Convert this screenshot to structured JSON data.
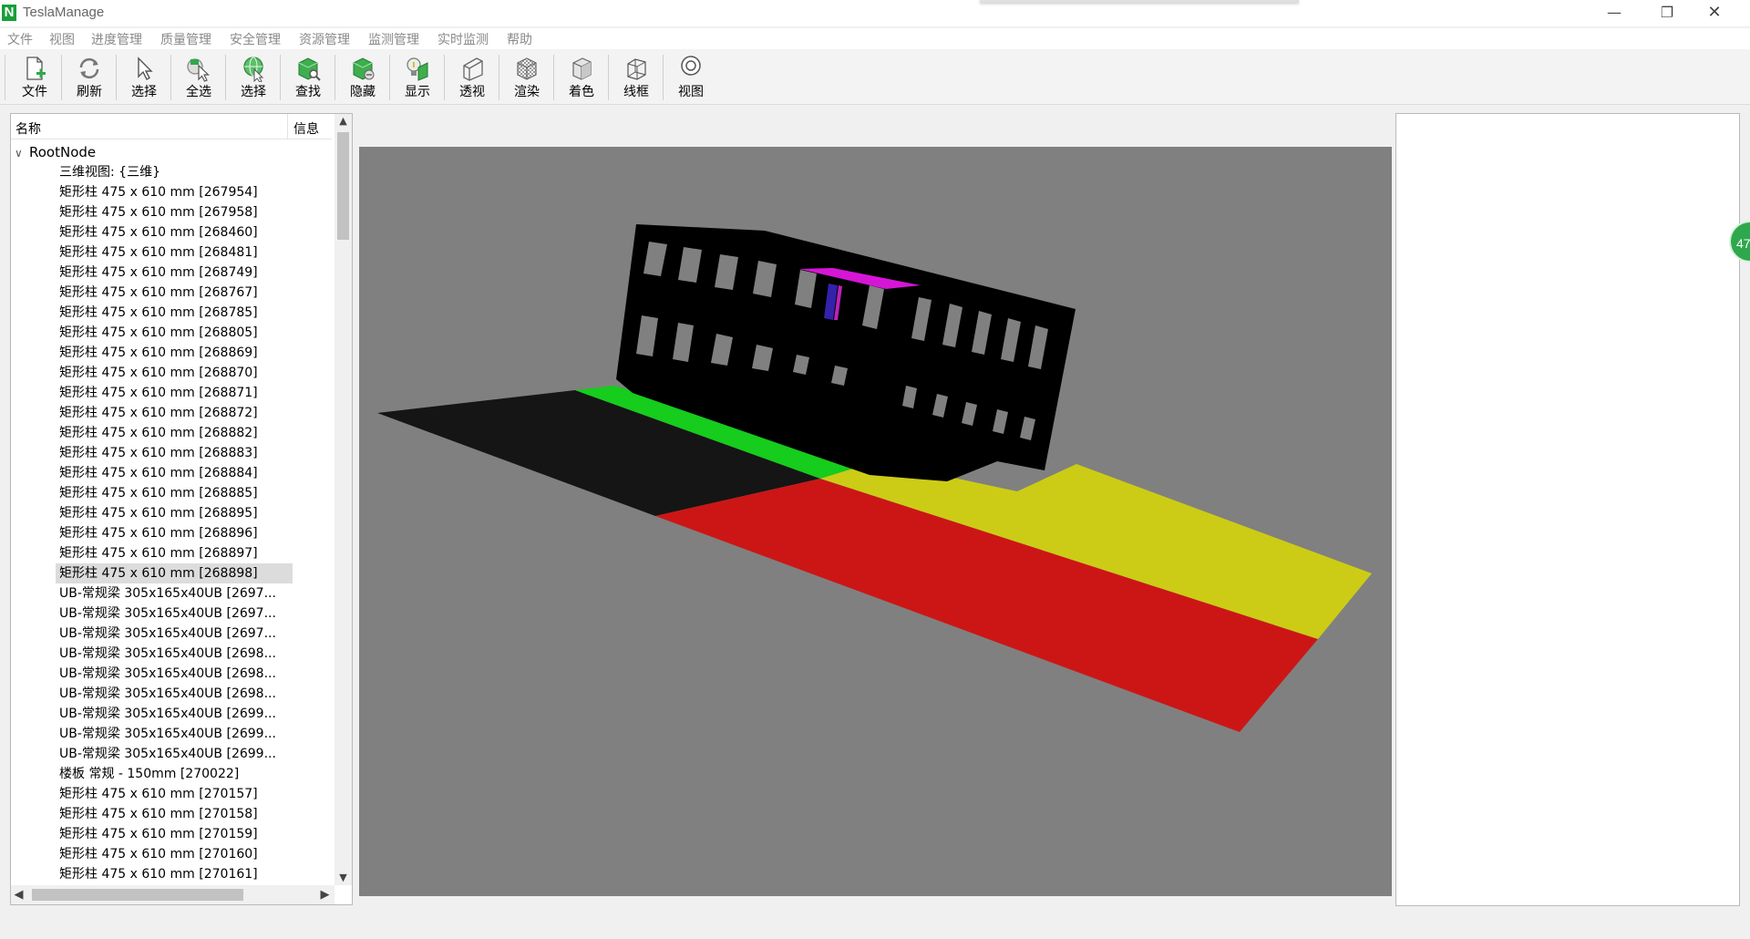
{
  "app": {
    "logo_letter": "N",
    "title": "TeslaManage",
    "minimize": "—",
    "maximize": "❐",
    "close": "✕"
  },
  "menu": [
    "文件",
    "视图",
    "进度管理",
    "质量管理",
    "安全管理",
    "资源管理",
    "监测管理",
    "实时监测",
    "帮助"
  ],
  "toolbar": [
    {
      "label": "文件",
      "icon": "new-file-icon"
    },
    {
      "label": "刷新",
      "icon": "refresh-icon"
    },
    {
      "label": "选择",
      "icon": "pointer-icon"
    },
    {
      "label": "全选",
      "icon": "select-all-icon"
    },
    {
      "label": "选择",
      "icon": "select-globe-icon"
    },
    {
      "label": "查找",
      "icon": "find-icon"
    },
    {
      "label": "隐藏",
      "icon": "hide-icon"
    },
    {
      "label": "显示",
      "icon": "show-icon"
    },
    {
      "label": "透视",
      "icon": "perspective-icon"
    },
    {
      "label": "渲染",
      "icon": "render-icon"
    },
    {
      "label": "着色",
      "icon": "shade-icon"
    },
    {
      "label": "线框",
      "icon": "wireframe-icon"
    },
    {
      "label": "视图",
      "icon": "view-icon"
    }
  ],
  "tree": {
    "col_name": "名称",
    "col_info": "信息",
    "root": "RootNode",
    "items": [
      "三维视图: {三维}",
      "矩形柱 475 x 610 mm [267954]",
      "矩形柱 475 x 610 mm [267958]",
      "矩形柱 475 x 610 mm [268460]",
      "矩形柱 475 x 610 mm [268481]",
      "矩形柱 475 x 610 mm [268749]",
      "矩形柱 475 x 610 mm [268767]",
      "矩形柱 475 x 610 mm [268785]",
      "矩形柱 475 x 610 mm [268805]",
      "矩形柱 475 x 610 mm [268869]",
      "矩形柱 475 x 610 mm [268870]",
      "矩形柱 475 x 610 mm [268871]",
      "矩形柱 475 x 610 mm [268872]",
      "矩形柱 475 x 610 mm [268882]",
      "矩形柱 475 x 610 mm [268883]",
      "矩形柱 475 x 610 mm [268884]",
      "矩形柱 475 x 610 mm [268885]",
      "矩形柱 475 x 610 mm [268895]",
      "矩形柱 475 x 610 mm [268896]",
      "矩形柱 475 x 610 mm [268897]",
      "矩形柱 475 x 610 mm [268898]",
      "UB-常规梁 305x165x40UB [2697...",
      "UB-常规梁 305x165x40UB [2697...",
      "UB-常规梁 305x165x40UB [2697...",
      "UB-常规梁 305x165x40UB [2698...",
      "UB-常规梁 305x165x40UB [2698...",
      "UB-常规梁 305x165x40UB [2698...",
      "UB-常规梁 305x165x40UB [2699...",
      "UB-常规梁 305x165x40UB [2699...",
      "UB-常规梁 305x165x40UB [2699...",
      "楼板 常规 - 150mm [270022]",
      "矩形柱 475 x 610 mm [270157]",
      "矩形柱 475 x 610 mm [270158]",
      "矩形柱 475 x 610 mm [270159]",
      "矩形柱 475 x 610 mm [270160]",
      "矩形柱 475 x 610 mm [270161]"
    ],
    "selected_index": 20
  },
  "viewport": {
    "background": "#808080",
    "zone_colors": {
      "dark": "#151515",
      "green": "#16cc1c",
      "yellow": "#cccc16",
      "red": "#cc1616",
      "building": "#000000",
      "highlight": "#d616d6"
    }
  },
  "badge": {
    "text": "47"
  }
}
